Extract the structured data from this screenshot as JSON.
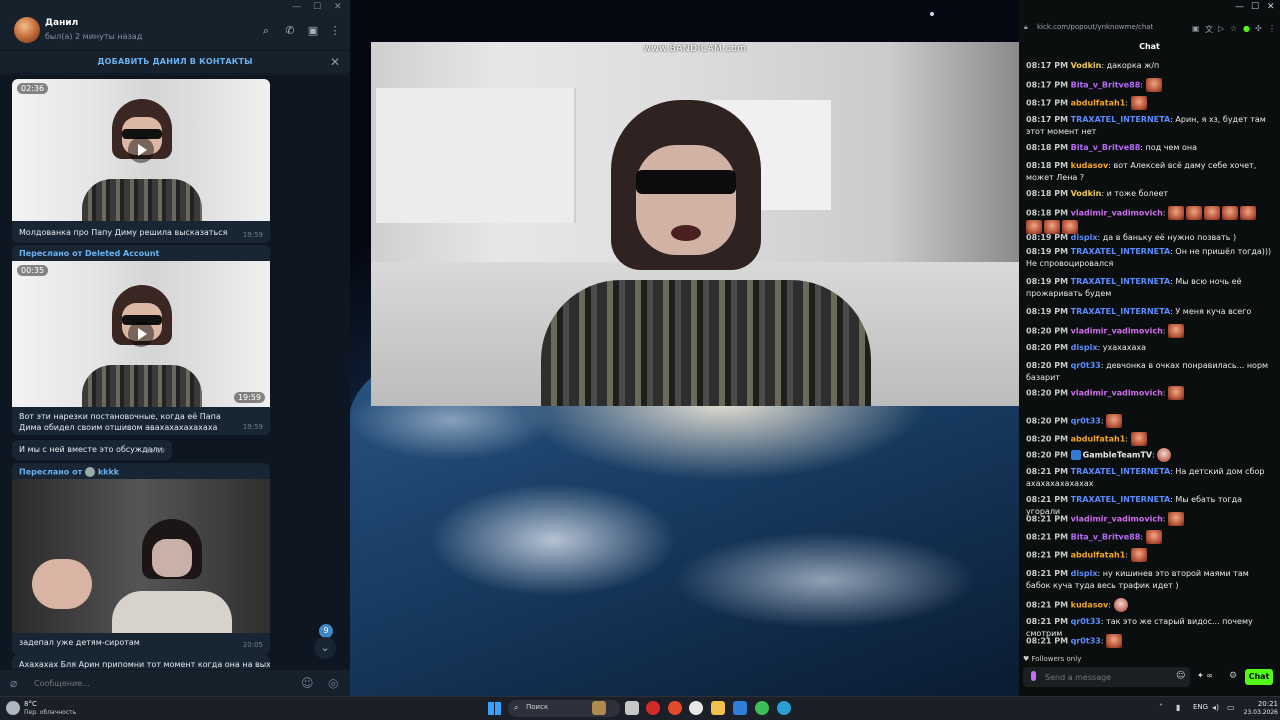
{
  "telegram": {
    "contact_name": "Данил",
    "contact_status": "был(а) 2 минуты назад",
    "add_contact_label": "ДОБАВИТЬ ДАНИЛ В КОНТАКТЫ",
    "input_placeholder": "Сообщение...",
    "unread_badge": "9",
    "messages": [
      {
        "duration": "02:36",
        "caption": "Молдованка про Папу Диму решила высказаться",
        "time": "19:59"
      },
      {
        "forwarded_from": "Переслано от Deleted Account",
        "duration": "00:35",
        "video_time": "19:59",
        "caption": "Вот эти нарезки постановочные, когда её Папа Дима обидел своим отшивом авахахахахахаха",
        "time": "19:59"
      },
      {
        "caption": "И мы с ней вместе это обсуждали",
        "time": "19:59"
      },
      {
        "forwarded_from": "Переслано от",
        "forwarded_name": "kkkk",
        "caption": "задепал уже детям-сиротам",
        "time": "20:05"
      },
      {
        "caption": "Ахахахах Бля Арин припомни тот момент когда она на выходах"
      }
    ]
  },
  "webcam": {
    "watermark": "www.BANDICAM.com"
  },
  "kick": {
    "url": "kick.com/popout/ynknowme/chat",
    "header": "Chat",
    "followers_only": "Followers only",
    "input_placeholder": "Send a message",
    "points": "∞",
    "send_label": "Chat",
    "colors": {
      "accent": "#53fc18",
      "purple": "#b56cf5",
      "blue": "#5b8cff",
      "orange": "#f5a623",
      "magenta": "#d06cf0"
    },
    "messages": [
      {
        "time": "08:17 PM",
        "user": "Vodkin",
        "color": "#f2c94c",
        "text": "дакорка ж/п",
        "emotes": 0
      },
      {
        "time": "08:17 PM",
        "user": "Bita_v_Britve88",
        "color": "#b56cf5",
        "text": "",
        "emotes": 1
      },
      {
        "time": "08:17 PM",
        "user": "abdulfatah1",
        "color": "#f5a623",
        "text": "",
        "emotes": 1
      },
      {
        "time": "08:17 PM",
        "user": "TRAXATEL_INTERNETA",
        "color": "#5b8cff",
        "text": "Арин, я хз, будет там этот момент нет",
        "emotes": 0
      },
      {
        "time": "08:18 PM",
        "user": "Bita_v_Britve88",
        "color": "#b56cf5",
        "text": "под чем она",
        "emotes": 0
      },
      {
        "time": "08:18 PM",
        "user": "kudasov",
        "color": "#f5a623",
        "text": "вот Алексей всё даму себе хочет, может Лена ?",
        "emotes": 0
      },
      {
        "time": "08:18 PM",
        "user": "Vodkin",
        "color": "#f2c94c",
        "text": "и тоже болеет",
        "emotes": 0
      },
      {
        "time": "08:18 PM",
        "user": "vladimir_vadimovich",
        "color": "#d06cf0",
        "text": "",
        "emotes": 8
      },
      {
        "time": "08:19 PM",
        "user": "dispix",
        "color": "#5b8cff",
        "text": "да в баньку её нужно позвать )",
        "emotes": 0
      },
      {
        "time": "08:19 PM",
        "user": "TRAXATEL_INTERNETA",
        "color": "#5b8cff",
        "text": "Он не пришёл тогда))) Не спровоцировался",
        "emotes": 0
      },
      {
        "time": "08:19 PM",
        "user": "TRAXATEL_INTERNETA",
        "color": "#5b8cff",
        "text": "Мы всю ночь её прожаривать будем",
        "emotes": 0
      },
      {
        "time": "08:19 PM",
        "user": "TRAXATEL_INTERNETA",
        "color": "#5b8cff",
        "text": "У меня куча всего",
        "emotes": 0
      },
      {
        "time": "08:20 PM",
        "user": "vladimir_vadimovich",
        "color": "#d06cf0",
        "text": "",
        "emotes": 1
      },
      {
        "time": "08:20 PM",
        "user": "dispix",
        "color": "#5b8cff",
        "text": "ухахахаха",
        "emotes": 0
      },
      {
        "time": "08:20 PM",
        "user": "qr0t33",
        "color": "#5b8cff",
        "text": "девчонка в очках понравилась... норм базарит",
        "emotes": 0
      },
      {
        "time": "08:20 PM",
        "user": "vladimir_vadimovich",
        "color": "#d06cf0",
        "text": "",
        "emotes": 1
      },
      {
        "time": "08:20 PM",
        "user": "qr0t33",
        "color": "#5b8cff",
        "text": "",
        "emotes": 1
      },
      {
        "time": "08:20 PM",
        "user": "abdulfatah1",
        "color": "#f5a623",
        "text": "",
        "emotes": 1
      },
      {
        "time": "08:20 PM",
        "user": "GambleTeamTV",
        "color": "#e8e8e8",
        "text": "",
        "emotes": 1
      },
      {
        "time": "08:21 PM",
        "user": "TRAXATEL_INTERNETA",
        "color": "#5b8cff",
        "text": "На детский дом сбор ахахахахахахах",
        "emotes": 0
      },
      {
        "time": "08:21 PM",
        "user": "TRAXATEL_INTERNETA",
        "color": "#5b8cff",
        "text": "Мы ебать тогда угорали",
        "emotes": 0
      },
      {
        "time": "08:21 PM",
        "user": "vladimir_vadimovich",
        "color": "#d06cf0",
        "text": "",
        "emotes": 1
      },
      {
        "time": "08:21 PM",
        "user": "Bita_v_Britve88",
        "color": "#b56cf5",
        "text": "",
        "emotes": 1
      },
      {
        "time": "08:21 PM",
        "user": "abdulfatah1",
        "color": "#f5a623",
        "text": "",
        "emotes": 1
      },
      {
        "time": "08:21 PM",
        "user": "dispix",
        "color": "#5b8cff",
        "text": "ну кишинев это второй маями там бабок куча туда весь трафик идет )",
        "emotes": 0
      },
      {
        "time": "08:21 PM",
        "user": "kudasov",
        "color": "#f5a623",
        "text": "",
        "emotes": 1
      },
      {
        "time": "08:21 PM",
        "user": "qr0t33",
        "color": "#5b8cff",
        "text": "так это же старый видос... почему смотрим",
        "emotes": 0
      },
      {
        "time": "08:21 PM",
        "user": "qr0t33",
        "color": "#5b8cff",
        "text": "",
        "emotes": 1
      }
    ]
  },
  "taskbar": {
    "weather_temp": "8°C",
    "weather_desc": "Пер. облачность",
    "search_label": "Поиск",
    "lang": "ENG",
    "time": "20:21",
    "date": "23.03.2026"
  }
}
